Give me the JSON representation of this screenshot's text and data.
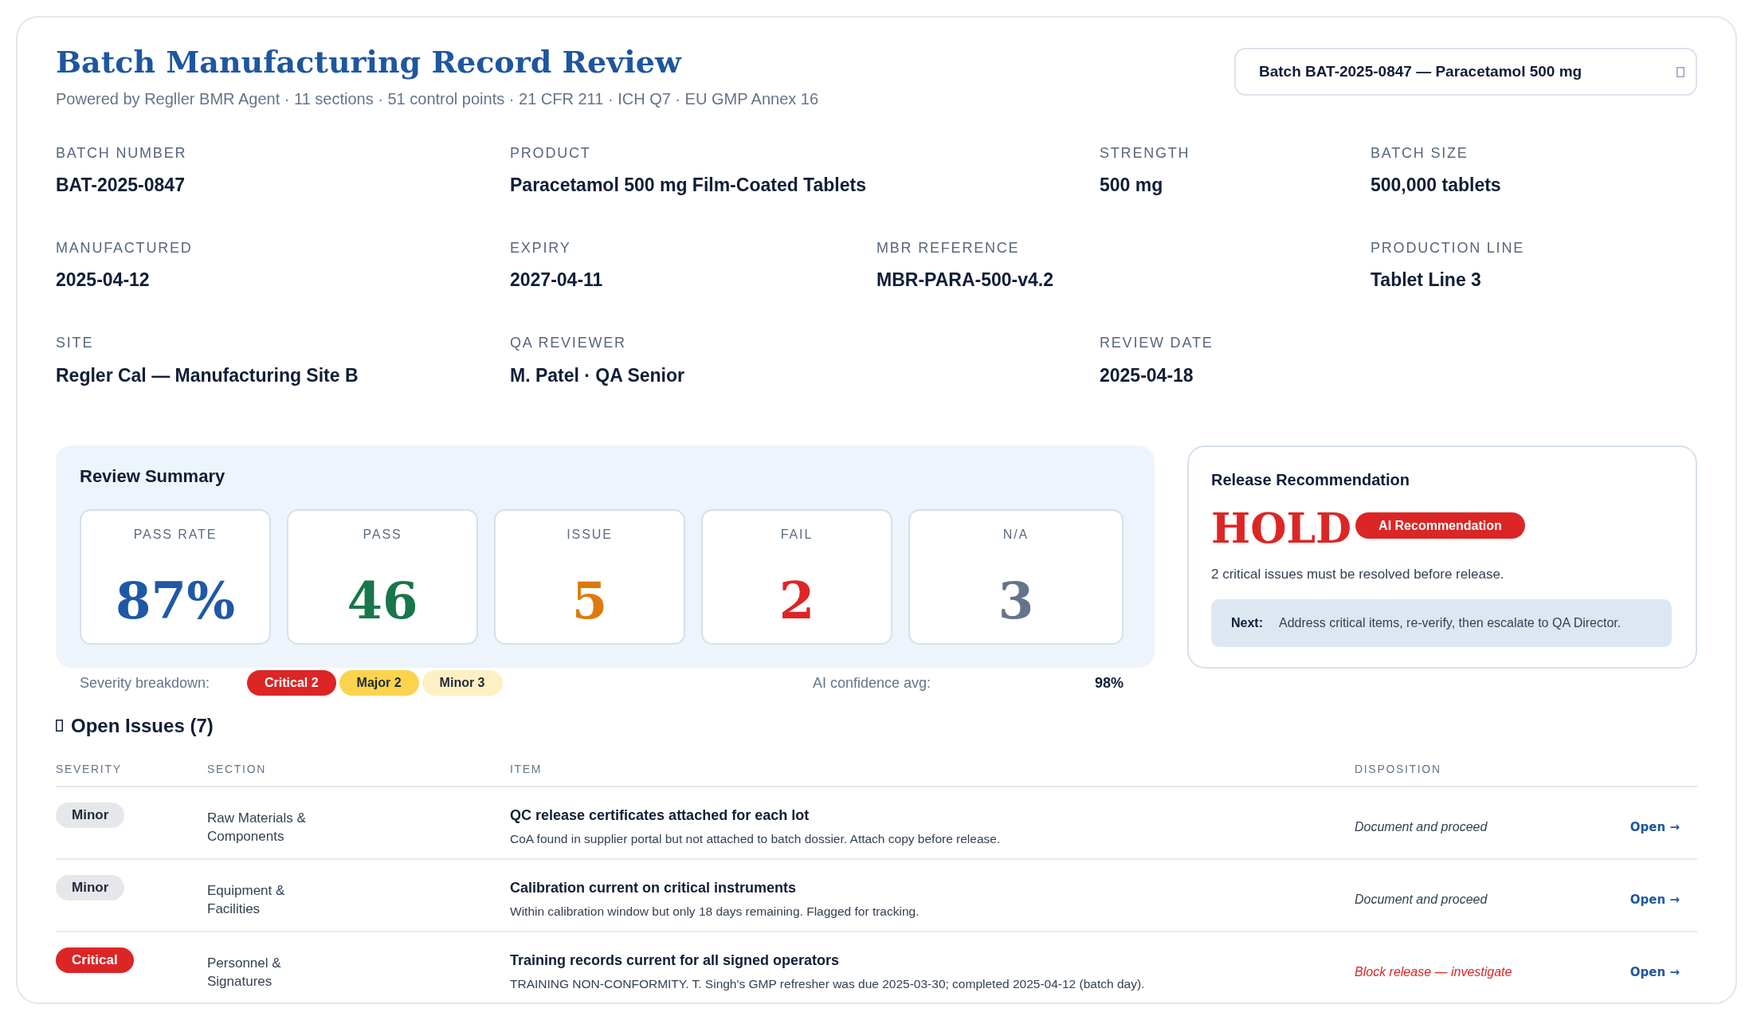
{
  "header": {
    "title": "Batch Manufacturing Record Review",
    "subtitle": "Powered by Regller BMR Agent · 11 sections · 51 control points · 21 CFR 211 · ICH Q7 · EU GMP Annex 16",
    "batch_selector": {
      "value": "Batch BAT-2025-0847 — Paracetamol 500 mg"
    }
  },
  "batch_details": [
    {
      "label": "BATCH NUMBER",
      "value": "BAT-2025-0847"
    },
    {
      "label": "PRODUCT",
      "value": "Paracetamol 500 mg Film-Coated Tablets"
    },
    {
      "label": "STRENGTH",
      "value": "500 mg"
    },
    {
      "label": "BATCH SIZE",
      "value": "500,000 tablets"
    },
    {
      "label": "MANUFACTURED",
      "value": "2025-04-12"
    },
    {
      "label": "EXPIRY",
      "value": "2027-04-11"
    },
    {
      "label": "MBR REFERENCE",
      "value": "MBR-PARA-500-v4.2"
    },
    {
      "label": "PRODUCTION LINE",
      "value": "Tablet Line 3"
    },
    {
      "label": "SITE",
      "value": "Regler Cal — Manufacturing Site B"
    },
    {
      "label": "QA REVIEWER",
      "value": "M. Patel · QA Senior"
    },
    {
      "label": "REVIEW DATE",
      "value": "2025-04-18"
    }
  ],
  "review_summary": {
    "title": "Review Summary",
    "stats": [
      {
        "kind": "rate",
        "label": "PASS RATE",
        "value": "87%"
      },
      {
        "kind": "pass",
        "label": "PASS",
        "value": "46"
      },
      {
        "kind": "issue",
        "label": "ISSUE",
        "value": "5"
      },
      {
        "kind": "fail",
        "label": "FAIL",
        "value": "2"
      },
      {
        "kind": "na",
        "label": "N/A",
        "value": "3"
      }
    ],
    "severity_breakdown": {
      "label": "Severity breakdown:",
      "counts": [
        {
          "kind": "critical",
          "label": "Critical 2"
        },
        {
          "kind": "major",
          "label": "Major 2"
        },
        {
          "kind": "minor",
          "label": "Minor 3"
        }
      ]
    },
    "confidence": {
      "label": "AI confidence avg:",
      "value": "98%"
    }
  },
  "release_recommendation": {
    "title": "Release Recommendation",
    "decision": {
      "kind": "hold",
      "label": "HOLD"
    },
    "badge": "AI Recommendation",
    "message": "2 critical issues must be resolved before release.",
    "next_step": {
      "label": "Next:",
      "text": "Address critical items, re-verify, then escalate to QA Director."
    }
  },
  "open_issues": {
    "title": "Open Issues (7)",
    "columns": [
      "SEVERITY",
      "SECTION",
      "ITEM",
      "DISPOSITION"
    ],
    "rows": [
      {
        "kind": "minor",
        "severity": "Minor",
        "section": "Raw Materials & Components",
        "item": "QC release certificates attached for each lot",
        "detail": "CoA found in supplier portal but not attached to batch dossier. Attach copy before release.",
        "disposition": "Document and proceed",
        "action": "Open →"
      },
      {
        "kind": "minor",
        "severity": "Minor",
        "section": "Equipment & Facilities",
        "item": "Calibration current on critical instruments",
        "detail": "Within calibration window but only 18 days remaining. Flagged for tracking.",
        "disposition": "Document and proceed",
        "action": "Open →"
      },
      {
        "kind": "critical",
        "severity": "Critical",
        "section": "Personnel & Signatures",
        "item": "Training records current for all signed operators",
        "detail": "TRAINING NON-CONFORMITY. T. Singh's GMP refresher was due 2025-03-30; completed 2025-04-12 (batch day).",
        "disposition": "Block release — investigate",
        "action": "Open →"
      }
    ]
  }
}
